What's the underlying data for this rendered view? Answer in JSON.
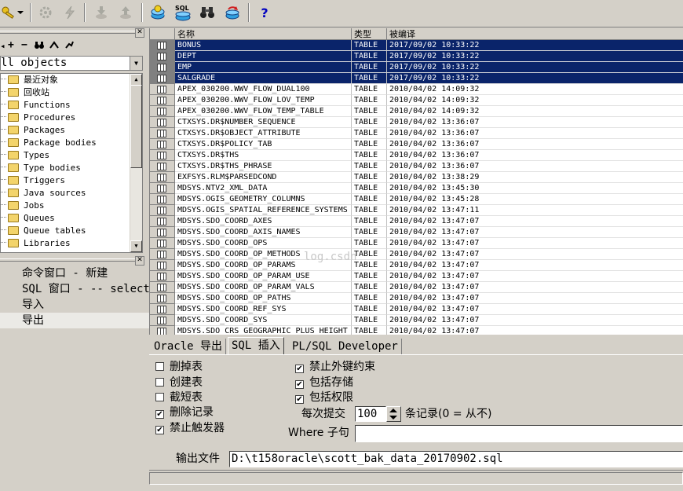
{
  "toolbar": {
    "icons": [
      "key-icon",
      "dropdown-arrow-icon",
      "gear-disabled-icon",
      "lightning-disabled-icon",
      "download-disabled-icon",
      "upload-disabled-icon",
      "database-icon",
      "sql-icon",
      "binoculars-icon",
      "refresh-db-icon",
      "help-icon"
    ],
    "sql_text": "SQL",
    "help_text": "?"
  },
  "object_browser": {
    "filter_value": "ll objects",
    "tree": [
      {
        "label": "最近对象"
      },
      {
        "label": "回收站"
      },
      {
        "label": "Functions"
      },
      {
        "label": "Procedures"
      },
      {
        "label": "Packages"
      },
      {
        "label": "Package bodies"
      },
      {
        "label": "Types"
      },
      {
        "label": "Type bodies"
      },
      {
        "label": "Triggers"
      },
      {
        "label": "Java sources"
      },
      {
        "label": "Jobs"
      },
      {
        "label": "Queues"
      },
      {
        "label": "Queue tables"
      },
      {
        "label": "Libraries"
      }
    ]
  },
  "window_list": {
    "items": [
      {
        "label": "命令窗口 - 新建"
      },
      {
        "label": "SQL 窗口 - -- select"
      },
      {
        "label": "导入"
      },
      {
        "label": "导出"
      }
    ]
  },
  "table_grid": {
    "columns": [
      "名称",
      "类型",
      "被编译"
    ],
    "rows": [
      {
        "name": "BONUS",
        "type": "TABLE",
        "compiled": "2017/09/02 10:33:22",
        "selected": true
      },
      {
        "name": "DEPT",
        "type": "TABLE",
        "compiled": "2017/09/02 10:33:22",
        "selected": true
      },
      {
        "name": "EMP",
        "type": "TABLE",
        "compiled": "2017/09/02 10:33:22",
        "selected": true
      },
      {
        "name": "SALGRADE",
        "type": "TABLE",
        "compiled": "2017/09/02 10:33:22",
        "selected": true
      },
      {
        "name": "APEX_030200.WWV_FLOW_DUAL100",
        "type": "TABLE",
        "compiled": "2010/04/02 14:09:32"
      },
      {
        "name": "APEX_030200.WWV_FLOW_LOV_TEMP",
        "type": "TABLE",
        "compiled": "2010/04/02 14:09:32"
      },
      {
        "name": "APEX_030200.WWV_FLOW_TEMP_TABLE",
        "type": "TABLE",
        "compiled": "2010/04/02 14:09:32"
      },
      {
        "name": "CTXSYS.DR$NUMBER_SEQUENCE",
        "type": "TABLE",
        "compiled": "2010/04/02 13:36:07"
      },
      {
        "name": "CTXSYS.DR$OBJECT_ATTRIBUTE",
        "type": "TABLE",
        "compiled": "2010/04/02 13:36:07"
      },
      {
        "name": "CTXSYS.DR$POLICY_TAB",
        "type": "TABLE",
        "compiled": "2010/04/02 13:36:07"
      },
      {
        "name": "CTXSYS.DR$THS",
        "type": "TABLE",
        "compiled": "2010/04/02 13:36:07"
      },
      {
        "name": "CTXSYS.DR$THS_PHRASE",
        "type": "TABLE",
        "compiled": "2010/04/02 13:36:07"
      },
      {
        "name": "EXFSYS.RLM$PARSEDCOND",
        "type": "TABLE",
        "compiled": "2010/04/02 13:38:29"
      },
      {
        "name": "MDSYS.NTV2_XML_DATA",
        "type": "TABLE",
        "compiled": "2010/04/02 13:45:30"
      },
      {
        "name": "MDSYS.OGIS_GEOMETRY_COLUMNS",
        "type": "TABLE",
        "compiled": "2010/04/02 13:45:28"
      },
      {
        "name": "MDSYS.OGIS_SPATIAL_REFERENCE_SYSTEMS",
        "type": "TABLE",
        "compiled": "2010/04/02 13:47:11"
      },
      {
        "name": "MDSYS.SDO_COORD_AXES",
        "type": "TABLE",
        "compiled": "2010/04/02 13:47:07"
      },
      {
        "name": "MDSYS.SDO_COORD_AXIS_NAMES",
        "type": "TABLE",
        "compiled": "2010/04/02 13:47:07"
      },
      {
        "name": "MDSYS.SDO_COORD_OPS",
        "type": "TABLE",
        "compiled": "2010/04/02 13:47:07"
      },
      {
        "name": "MDSYS.SDO_COORD_OP_METHODS",
        "type": "TABLE",
        "compiled": "2010/04/02 13:47:07"
      },
      {
        "name": "MDSYS.SDO_COORD_OP_PARAMS",
        "type": "TABLE",
        "compiled": "2010/04/02 13:47:07"
      },
      {
        "name": "MDSYS.SDO_COORD_OP_PARAM_USE",
        "type": "TABLE",
        "compiled": "2010/04/02 13:47:07"
      },
      {
        "name": "MDSYS.SDO_COORD_OP_PARAM_VALS",
        "type": "TABLE",
        "compiled": "2010/04/02 13:47:07"
      },
      {
        "name": "MDSYS.SDO_COORD_OP_PATHS",
        "type": "TABLE",
        "compiled": "2010/04/02 13:47:07"
      },
      {
        "name": "MDSYS.SDO_COORD_REF_SYS",
        "type": "TABLE",
        "compiled": "2010/04/02 13:47:07"
      },
      {
        "name": "MDSYS.SDO_COORD_SYS",
        "type": "TABLE",
        "compiled": "2010/04/02 13:47:07"
      },
      {
        "name": "MDSYS.SDO_CRS_GEOGRAPHIC_PLUS_HEIGHT",
        "type": "TABLE",
        "compiled": "2010/04/02 13:47:07"
      }
    ]
  },
  "export_tabs": {
    "tabs": [
      "Oracle 导出",
      "SQL 插入",
      "PL/SQL Developer"
    ],
    "active_index": 1
  },
  "options": {
    "drop_tables": {
      "label": "删掉表",
      "checked": false
    },
    "create_tables": {
      "label": "创建表",
      "checked": false
    },
    "truncate_tables": {
      "label": "截短表",
      "checked": false
    },
    "delete_records": {
      "label": "删除记录",
      "checked": true
    },
    "disable_triggers": {
      "label": "禁止触发器",
      "checked": true
    },
    "disable_fk": {
      "label": "禁止外键约束",
      "checked": true
    },
    "include_storage": {
      "label": "包括存储",
      "checked": true
    },
    "include_privileges": {
      "label": "包括权限",
      "checked": true
    }
  },
  "commit": {
    "label": "每次提交",
    "value": "100",
    "suffix": "条记录(0 = 从不)"
  },
  "where": {
    "label": "Where 子句",
    "value": ""
  },
  "output": {
    "label": "输出文件",
    "value": "D:\\t158oracle\\scott_bak_data_20170902.sql"
  },
  "watermark": "log.csdn"
}
